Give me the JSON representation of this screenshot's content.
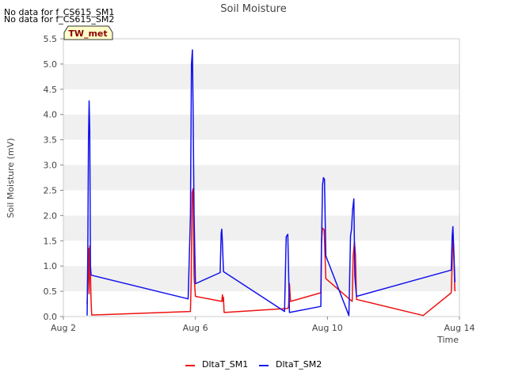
{
  "chart_data": {
    "type": "line",
    "title": "Soil Moisture",
    "xlabel": "Time",
    "ylabel": "Soil Moisture (mV)",
    "no_data_notes": [
      "No data for f_CS615_SM1",
      "No data for f_CS615_SM2"
    ],
    "site_badge": "TW_met",
    "x_domain": [
      "Aug 2",
      "Aug 14"
    ],
    "x_ticks": [
      {
        "label": "Aug 2",
        "day": 2
      },
      {
        "label": "Aug 6",
        "day": 6
      },
      {
        "label": "Aug 10",
        "day": 10
      },
      {
        "label": "Aug 14",
        "day": 14
      }
    ],
    "ylim": [
      0,
      5.5
    ],
    "y_ticks": [
      "0.0",
      "0.5",
      "1.0",
      "1.5",
      "2.0",
      "2.5",
      "3.0",
      "3.5",
      "4.0",
      "4.5",
      "5.0",
      "5.5"
    ],
    "grid": "horizontal alternating bands",
    "legend_placement": "bottom-center",
    "series": [
      {
        "name": "DltaT_SM1",
        "color": "#ee1111",
        "points": [
          [
            2.72,
            0.24
          ],
          [
            2.76,
            1.35
          ],
          [
            2.78,
            0.45
          ],
          [
            2.8,
            1.4
          ],
          [
            2.84,
            0.3
          ],
          [
            2.86,
            0.03
          ],
          [
            5.85,
            0.1
          ],
          [
            5.87,
            0.7
          ],
          [
            5.9,
            2.45
          ],
          [
            5.93,
            2.53
          ],
          [
            5.96,
            0.8
          ],
          [
            6.0,
            0.4
          ],
          [
            6.8,
            0.3
          ],
          [
            6.82,
            0.43
          ],
          [
            6.84,
            0.3
          ],
          [
            6.85,
            0.38
          ],
          [
            6.87,
            0.08
          ],
          [
            8.8,
            0.16
          ],
          [
            8.82,
            0.2
          ],
          [
            8.85,
            0.65
          ],
          [
            8.88,
            0.3
          ],
          [
            9.8,
            0.47
          ],
          [
            9.82,
            1.5
          ],
          [
            9.85,
            1.75
          ],
          [
            9.9,
            1.72
          ],
          [
            9.95,
            0.75
          ],
          [
            10.75,
            0.3
          ],
          [
            10.78,
            1.2
          ],
          [
            10.82,
            1.48
          ],
          [
            10.85,
            1.22
          ],
          [
            10.88,
            0.34
          ],
          [
            12.9,
            0.02
          ],
          [
            13.75,
            0.47
          ],
          [
            13.78,
            1.05
          ],
          [
            13.8,
            1.68
          ],
          [
            13.83,
            1.2
          ],
          [
            13.86,
            0.5
          ]
        ]
      },
      {
        "name": "DltaT_SM2",
        "color": "#1111ee",
        "points": [
          [
            2.72,
            0.02
          ],
          [
            2.74,
            1.2
          ],
          [
            2.76,
            3.5
          ],
          [
            2.78,
            4.27
          ],
          [
            2.8,
            3.7
          ],
          [
            2.82,
            1.0
          ],
          [
            2.84,
            0.82
          ],
          [
            5.78,
            0.35
          ],
          [
            5.85,
            2.0
          ],
          [
            5.88,
            5.0
          ],
          [
            5.91,
            5.28
          ],
          [
            5.93,
            4.2
          ],
          [
            5.96,
            2.0
          ],
          [
            6.0,
            0.65
          ],
          [
            6.75,
            0.87
          ],
          [
            6.78,
            1.65
          ],
          [
            6.8,
            1.73
          ],
          [
            6.82,
            1.45
          ],
          [
            6.85,
            0.89
          ],
          [
            8.7,
            0.1
          ],
          [
            8.75,
            1.58
          ],
          [
            8.8,
            1.63
          ],
          [
            8.85,
            0.08
          ],
          [
            9.8,
            0.2
          ],
          [
            9.82,
            1.3
          ],
          [
            9.85,
            2.6
          ],
          [
            9.88,
            2.75
          ],
          [
            9.91,
            2.72
          ],
          [
            9.95,
            1.2
          ],
          [
            10.65,
            0.02
          ],
          [
            10.7,
            1.6
          ],
          [
            10.73,
            1.73
          ],
          [
            10.76,
            2.1
          ],
          [
            10.8,
            2.33
          ],
          [
            10.83,
            0.8
          ],
          [
            10.88,
            0.4
          ],
          [
            13.75,
            0.92
          ],
          [
            13.78,
            1.6
          ],
          [
            13.8,
            1.78
          ],
          [
            13.83,
            1.3
          ],
          [
            13.86,
            0.68
          ]
        ]
      }
    ]
  }
}
